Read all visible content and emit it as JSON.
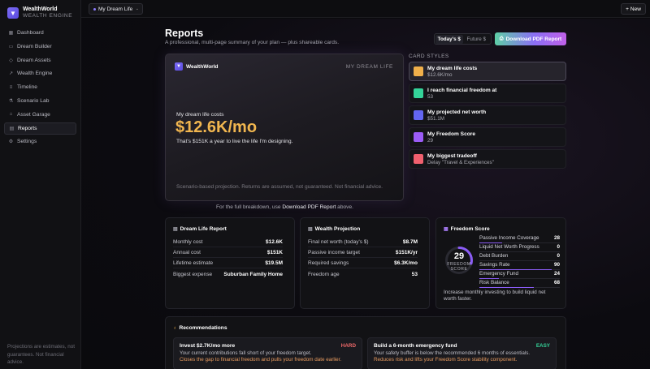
{
  "brand": {
    "name": "WealthWorld",
    "sub": "WEALTH ENGINE"
  },
  "sidebar": {
    "items": [
      {
        "label": "Dashboard",
        "icon": "grid-icon"
      },
      {
        "label": "Dream Builder",
        "icon": "blueprint-icon"
      },
      {
        "label": "Dream Assets",
        "icon": "diamond-icon"
      },
      {
        "label": "Wealth Engine",
        "icon": "trend-icon"
      },
      {
        "label": "Timeline",
        "icon": "timeline-icon"
      },
      {
        "label": "Scenario Lab",
        "icon": "flask-icon"
      },
      {
        "label": "Asset Garage",
        "icon": "garage-icon"
      },
      {
        "label": "Reports",
        "icon": "report-icon",
        "active": true
      },
      {
        "label": "Settings",
        "icon": "gear-icon"
      }
    ],
    "footer": "Projections are estimates, not guarantees. Not financial advice."
  },
  "topbar": {
    "plan": "My Dream Life",
    "new_label": "New"
  },
  "page": {
    "title": "Reports",
    "subtitle": "A professional, multi-page summary of your plan — plus shareable cards.",
    "toggle": [
      "Today's $",
      "Future $"
    ],
    "download_label": "Download PDF Report"
  },
  "preview": {
    "brand": "WealthWorld",
    "plan": "MY DREAM LIFE",
    "label": "My dream life costs",
    "value": "$12.6K/mo",
    "desc": "That's $151K a year to live the life I'm designing.",
    "foot": "Scenario-based projection. Returns are assumed, not guaranteed. Not financial advice.",
    "note_pre": "For the full breakdown, use ",
    "note_link": "Download PDF Report",
    "note_post": " above."
  },
  "card_styles": {
    "heading": "CARD STYLES",
    "items": [
      {
        "title": "My dream life costs",
        "sub": "$12.6K/mo",
        "color": "#f0b04a"
      },
      {
        "title": "I reach financial freedom at",
        "sub": "53",
        "color": "#34d399"
      },
      {
        "title": "My projected net worth",
        "sub": "$51.1M",
        "color": "#6366f1"
      },
      {
        "title": "My Freedom Score",
        "sub": "29",
        "color": "#9b5cf6"
      },
      {
        "title": "My biggest tradeoff",
        "sub": "Delay \"Travel & Experiences\"",
        "color": "#f0606e"
      }
    ]
  },
  "dream_report": {
    "title": "Dream Life Report",
    "rows": [
      {
        "k": "Monthly cost",
        "v": "$12.6K"
      },
      {
        "k": "Annual cost",
        "v": "$151K"
      },
      {
        "k": "Lifetime estimate",
        "v": "$19.5M"
      },
      {
        "k": "Biggest expense",
        "v": "Suburban Family Home"
      }
    ]
  },
  "wealth_projection": {
    "title": "Wealth Projection",
    "rows": [
      {
        "k": "Final net worth (today's $)",
        "v": "$8.7M"
      },
      {
        "k": "Passive income target",
        "v": "$151K/yr"
      },
      {
        "k": "Required savings",
        "v": "$6.3K/mo"
      },
      {
        "k": "Freedom age",
        "v": "53"
      }
    ]
  },
  "freedom_score": {
    "title": "Freedom Score",
    "score": "29",
    "score_value": 29,
    "label": "FREEDOM SCORE",
    "rows": [
      {
        "k": "Passive Income Coverage",
        "v": "28",
        "pct": 28
      },
      {
        "k": "Liquid Net Worth Progress",
        "v": "0",
        "pct": 0
      },
      {
        "k": "Debt Burden",
        "v": "0",
        "pct": 0
      },
      {
        "k": "Savings Rate",
        "v": "90",
        "pct": 90
      },
      {
        "k": "Emergency Fund",
        "v": "24",
        "pct": 24
      },
      {
        "k": "Risk Balance",
        "v": "68",
        "pct": 68
      }
    ],
    "note": "Increase monthly investing to build liquid net worth faster."
  },
  "recommendations": {
    "title": "Recommendations",
    "items": [
      {
        "title": "Invest $2.7K/mo more",
        "tag": "HARD",
        "tag_color": "#f06a6a",
        "line1": "Your current contributions fall short of your freedom target.",
        "line2": "Closes the gap to financial freedom and pulls your freedom date earlier."
      },
      {
        "title": "Build a 6-month emergency fund",
        "tag": "EASY",
        "tag_color": "#34d399",
        "line1": "Your safety buffer is below the recommended 6 months of essentials.",
        "line2": "Reduces risk and lifts your Freedom Score stability component."
      }
    ]
  }
}
